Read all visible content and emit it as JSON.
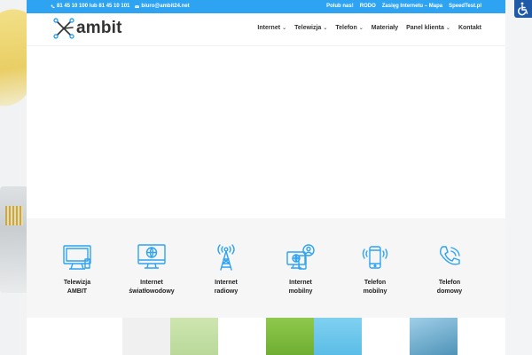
{
  "topbar": {
    "phone": "81 45 10 100 lub 81 45 10 101",
    "email": "biuro@ambit24.net",
    "links": [
      "Polub nas!",
      "RODO",
      "Zasięg Internetu – Mapa",
      "SpeedTest.pl"
    ]
  },
  "header": {
    "logo_text": "ambit",
    "nav": [
      {
        "label": "Internet",
        "has_submenu": true
      },
      {
        "label": "Telewizja",
        "has_submenu": true
      },
      {
        "label": "Telefon",
        "has_submenu": true
      },
      {
        "label": "Materiały",
        "has_submenu": false
      },
      {
        "label": "Panel klienta",
        "has_submenu": true
      },
      {
        "label": "Kontakt",
        "has_submenu": false
      }
    ],
    "chevron": "⌄"
  },
  "services": [
    {
      "label": "Telewizja\nAMBIT",
      "icon": "tv-icon"
    },
    {
      "label": "Internet\nświatłowodowy",
      "icon": "monitor-globe-icon"
    },
    {
      "label": "Internet\nradiowy",
      "icon": "radio-tower-icon"
    },
    {
      "label": "Internet\nmobilny",
      "icon": "devices-user-icon"
    },
    {
      "label": "Telefon\nmobilny",
      "icon": "smartphone-icon"
    },
    {
      "label": "Telefon\ndomowy",
      "icon": "phone-handset-icon"
    }
  ],
  "colors": {
    "accent": "#2ea3f2",
    "icon": "#2ea3f2",
    "accessibility_button": "#1f5aa8"
  }
}
